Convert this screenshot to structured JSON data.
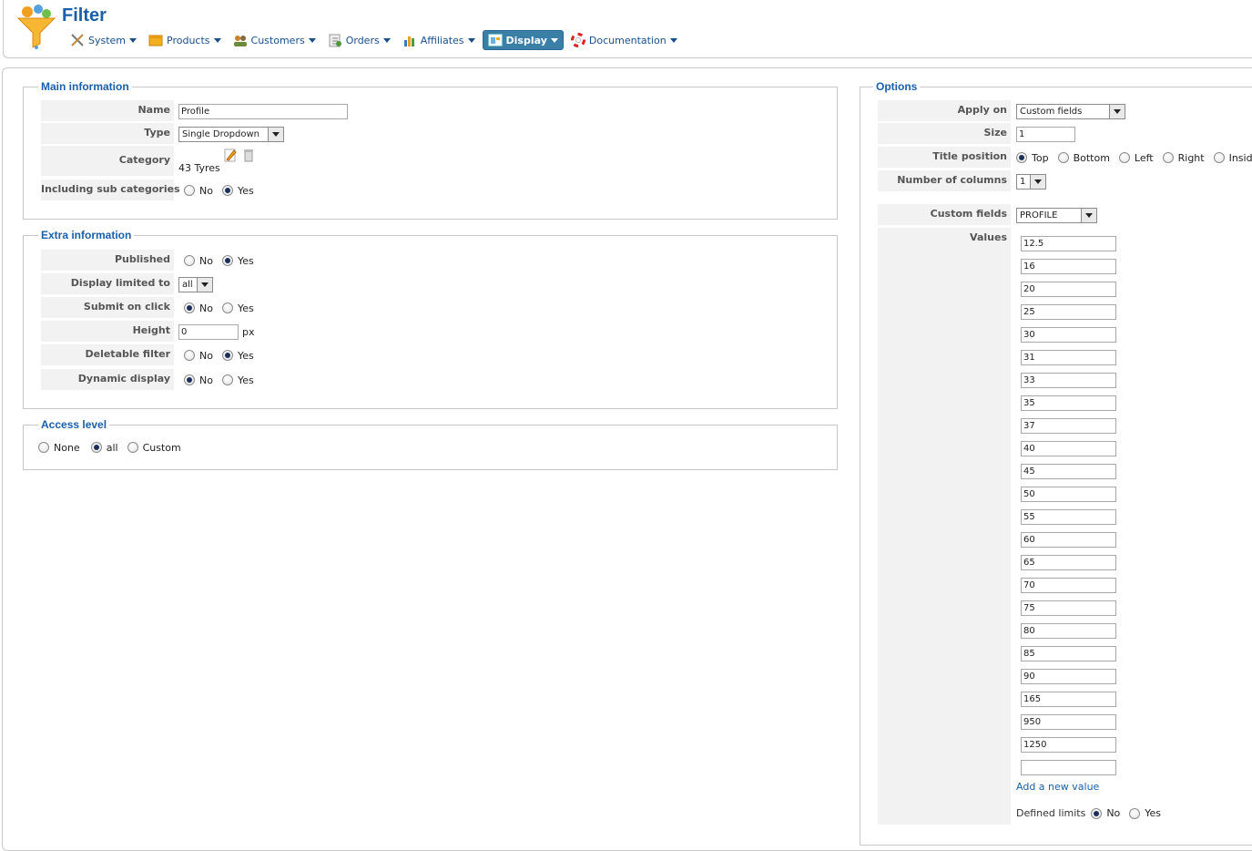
{
  "header": {
    "title": "Filter",
    "menu": [
      {
        "label": "System",
        "icon": "tools-icon"
      },
      {
        "label": "Products",
        "icon": "box-icon"
      },
      {
        "label": "Customers",
        "icon": "users-icon"
      },
      {
        "label": "Orders",
        "icon": "orders-icon"
      },
      {
        "label": "Affiliates",
        "icon": "affiliates-icon"
      },
      {
        "label": "Display",
        "icon": "display-icon",
        "active": true
      },
      {
        "label": "Documentation",
        "icon": "lifebuoy-icon"
      }
    ]
  },
  "main_info": {
    "legend": "Main information",
    "name_label": "Name",
    "name_value": "Profile",
    "type_label": "Type",
    "type_value": "Single Dropdown",
    "category_label": "Category",
    "category_value": "43 Tyres",
    "subcat_label": "Including sub categories",
    "subcat_no": "No",
    "subcat_yes": "Yes",
    "subcat_selected": "Yes"
  },
  "extra_info": {
    "legend": "Extra information",
    "published_label": "Published",
    "published_selected": "Yes",
    "display_limited_label": "Display limited to",
    "display_limited_value": "all",
    "submit_label": "Submit on click",
    "submit_selected": "No",
    "height_label": "Height",
    "height_value": "0",
    "height_unit": "px",
    "deletable_label": "Deletable filter",
    "deletable_selected": "Yes",
    "dynamic_label": "Dynamic display",
    "dynamic_selected": "No",
    "no": "No",
    "yes": "Yes"
  },
  "access": {
    "legend": "Access level",
    "none": "None",
    "all": "all",
    "custom": "Custom",
    "selected": "all"
  },
  "options": {
    "legend": "Options",
    "apply_on_label": "Apply on",
    "apply_on_value": "Custom fields",
    "size_label": "Size",
    "size_value": "1",
    "title_position_label": "Title position",
    "title_positions": [
      "Top",
      "Bottom",
      "Left",
      "Right",
      "Inside"
    ],
    "title_position_selected": "Top",
    "columns_label": "Number of columns",
    "columns_value": "1",
    "custom_fields_label": "Custom fields",
    "custom_fields_value": "PROFILE",
    "values_label": "Values",
    "values": [
      "12.5",
      "16",
      "20",
      "25",
      "30",
      "31",
      "33",
      "35",
      "37",
      "40",
      "45",
      "50",
      "55",
      "60",
      "65",
      "70",
      "75",
      "80",
      "85",
      "90",
      "165",
      "950",
      "1250",
      ""
    ],
    "add_value_link": "Add a new value",
    "defined_limits_label": "Defined limits",
    "defined_limits_no": "No",
    "defined_limits_yes": "Yes",
    "defined_limits_selected": "No"
  }
}
